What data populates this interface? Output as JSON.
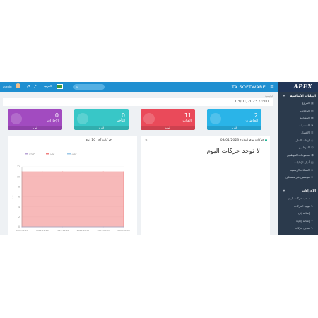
{
  "topbar": {
    "logo": "APEX",
    "app_name": "TA SOFTWARE",
    "menu_icon": "hamburger-icon",
    "search_icon": "search-icon",
    "language": "العربية",
    "user_label": "admin"
  },
  "sidebar": {
    "section1": "البيانات الأساسية",
    "items1": [
      {
        "label": "الفروع",
        "icon": "building-icon"
      },
      {
        "label": "الوظائف",
        "icon": "briefcase-icon"
      },
      {
        "label": "المشاريع",
        "icon": "project-icon"
      },
      {
        "label": "الجنسيات",
        "icon": "flag-icon"
      },
      {
        "label": "الأقسام",
        "icon": "sitemap-icon"
      },
      {
        "label": "أوقات العمل",
        "icon": "clock-icon"
      },
      {
        "label": "الموظفين",
        "icon": "users-icon"
      },
      {
        "label": "مجموعات الموظفين",
        "icon": "group-icon"
      },
      {
        "label": "أنواع الإجازات",
        "icon": "calendar-icon"
      },
      {
        "label": "العطلات الرسمية",
        "icon": "holiday-icon"
      },
      {
        "label": "موظفين غير مسجلين",
        "icon": "user-x-icon"
      }
    ],
    "section2": "الإجراءات",
    "items2": [
      {
        "label": "سحب حركات اليوم",
        "icon": "download-icon"
      },
      {
        "label": "توليد الحركات",
        "icon": "refresh-icon"
      },
      {
        "label": "إضافة إذن",
        "icon": "plus-icon"
      },
      {
        "label": "إضافة إجازة",
        "icon": "plus-icon"
      },
      {
        "label": "تعديل حركات",
        "icon": "edit-icon"
      }
    ]
  },
  "breadcrumb": "الرئيسية",
  "date_bar": "الثلاثاء 03/01/2023",
  "cards": [
    {
      "value": "2",
      "label": "الحاضرين",
      "more": "المزيد",
      "color": "#2ab4e8"
    },
    {
      "value": "11",
      "label": "الغياب",
      "more": "المزيد",
      "color": "#ea4a5a"
    },
    {
      "value": "0",
      "label": "التأخير",
      "more": "المزيد",
      "color": "#38c7c7"
    },
    {
      "value": "0",
      "label": "الإجازات",
      "more": "المزيد",
      "color": "#a24bc0"
    }
  ],
  "today_panel": {
    "title": "حركات يوم الثلاثاء 03/01/2023",
    "chevron_icon": "chevron-left-icon",
    "empty_message": "لا توجد حركات اليوم"
  },
  "chart_panel": {
    "title": "حركات آخر 10 ايام"
  },
  "chart_data": {
    "type": "area",
    "x": [
      "2022-12-24",
      "2022-12-26",
      "2022-12-28",
      "2022-12-30",
      "2023-01-01",
      "2023-01-03"
    ],
    "series": [
      {
        "name": "غياب",
        "values": [
          11,
          11,
          11,
          11,
          11,
          11
        ],
        "color": "#f08080"
      },
      {
        "name": "حضور",
        "values": [
          0,
          0,
          0,
          0,
          0,
          0
        ],
        "color": "#9ec9e8"
      },
      {
        "name": "إجازات",
        "values": [
          0,
          0,
          0,
          0,
          0,
          0
        ],
        "color": "#b9a5d6"
      }
    ],
    "legend_labels": [
      "حضور",
      "غياب",
      "إجازات"
    ],
    "yticks": [
      0,
      2,
      4,
      6,
      8,
      10,
      12
    ],
    "ylim": [
      0,
      12
    ],
    "ylabel": "عدد",
    "grid": true,
    "legend": "top"
  }
}
